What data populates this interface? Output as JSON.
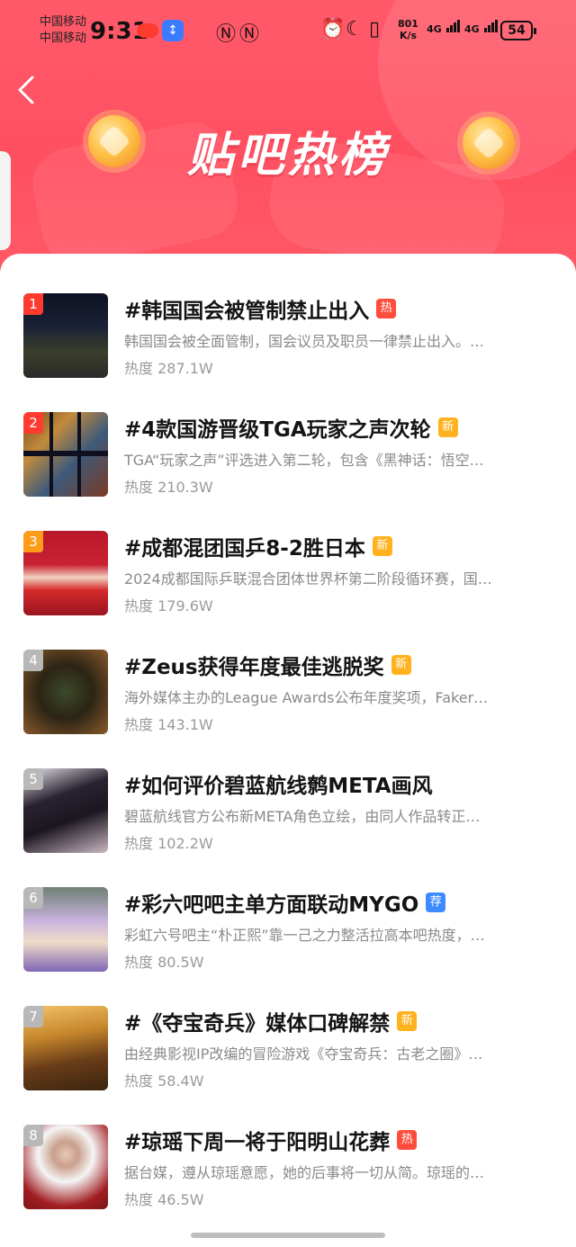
{
  "status_bar": {
    "carrier_1": "中国移动",
    "carrier_2": "中国移动",
    "time": "9:31",
    "net_speed_value": "801",
    "net_speed_unit": "K/s",
    "signal_1": "4G",
    "signal_2": "4G",
    "battery": "54"
  },
  "header": {
    "title": "贴吧热榜",
    "back_icon": "chevron-left-icon",
    "colors": {
      "header_bg": "#ff5066",
      "rank_top": "#ff3b30",
      "rank_2": "#ff3b30",
      "rank_3": "#ff9c1a",
      "rank_other": "#b8b8b8",
      "tag_hot": "#ff4d3d",
      "tag_new": "#ffb21e",
      "tag_rec": "#3d8bff"
    }
  },
  "items": [
    {
      "rank": "1",
      "title": "#韩国国会被管制禁止出入",
      "tag": "热",
      "tag_type": "hot",
      "desc": "韩国国会被全面管制，国会议员及职员一律禁止出入。…",
      "heat": "热度 287.1W"
    },
    {
      "rank": "2",
      "title": "#4款国游晋级TGA玩家之声次轮",
      "tag": "新",
      "tag_type": "new",
      "desc": "TGA“玩家之声”评选进入第二轮，包含《黑神话：悟空…",
      "heat": "热度 210.3W"
    },
    {
      "rank": "3",
      "title": "#成都混团国乒8-2胜日本",
      "tag": "新",
      "tag_type": "new",
      "desc": "2024成都国际乒联混合团体世界杯第二阶段循环赛，国…",
      "heat": "热度 179.6W"
    },
    {
      "rank": "4",
      "title": "#Zeus获得年度最佳逃脱奖",
      "tag": "新",
      "tag_type": "new",
      "desc": "海外媒体主办的League Awards公布年度奖项，Faker…",
      "heat": "热度 143.1W"
    },
    {
      "rank": "5",
      "title": "#如何评价碧蓝航线鹩META画风",
      "tag": "",
      "tag_type": "none",
      "desc": "碧蓝航线官方公布新META角色立绘，由同人作品转正…",
      "heat": "热度 102.2W"
    },
    {
      "rank": "6",
      "title": "#彩六吧吧主单方面联动MYGO",
      "tag": "荐",
      "tag_type": "rec",
      "desc": "彩虹六号吧主“朴正熙”靠一己之力整活拉高本吧热度，…",
      "heat": "热度 80.5W"
    },
    {
      "rank": "7",
      "title": "#《夺宝奇兵》媒体口碑解禁",
      "tag": "新",
      "tag_type": "new",
      "desc": "由经典影视IP改编的冒险游戏《夺宝奇兵：古老之圈》…",
      "heat": "热度 58.4W"
    },
    {
      "rank": "8",
      "title": "#琼瑶下周一将于阳明山花葬",
      "tag": "热",
      "tag_type": "hot",
      "desc": "据台媒，遵从琼瑶意愿，她的后事将一切从简。琼瑶的…",
      "heat": "热度 46.5W"
    }
  ]
}
